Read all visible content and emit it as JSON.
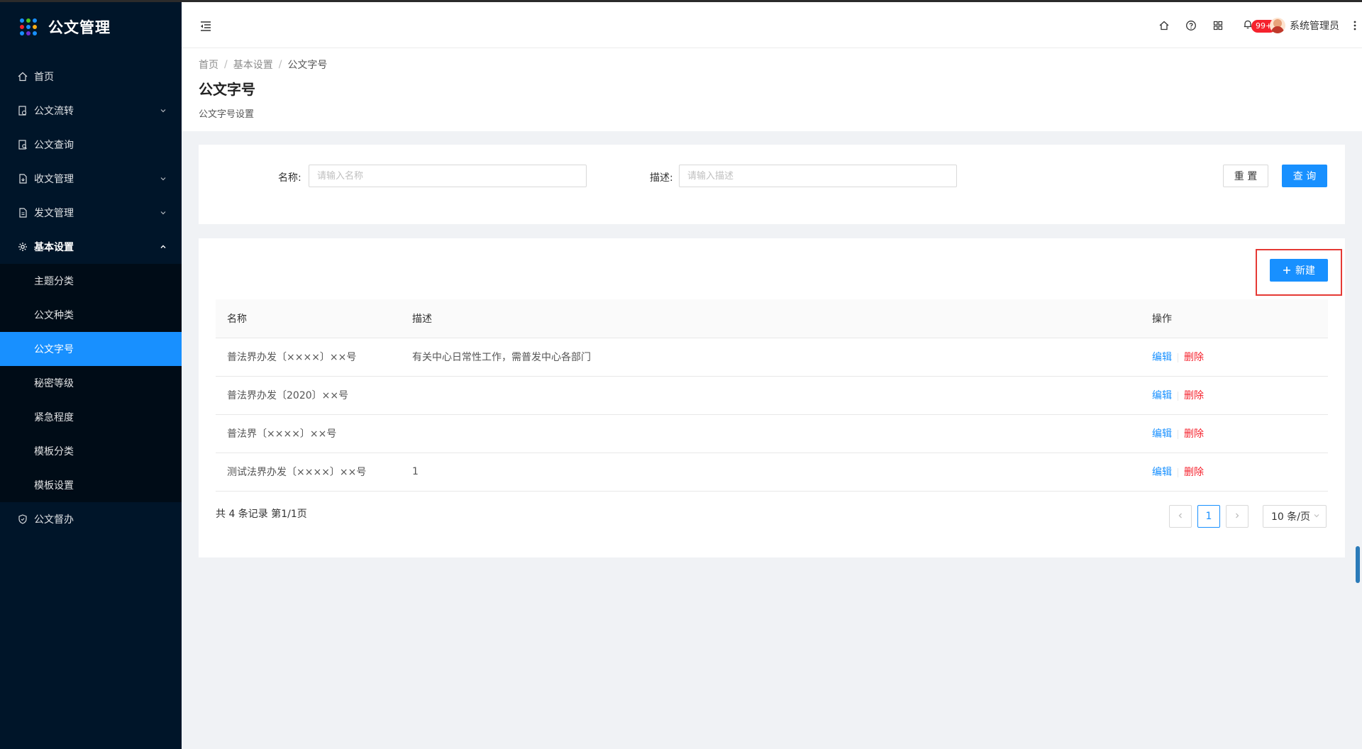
{
  "app": {
    "title": "公文管理"
  },
  "sidebar": {
    "items": [
      {
        "label": "首页",
        "icon": "home-icon"
      },
      {
        "label": "公文流转",
        "icon": "document-flow-icon"
      },
      {
        "label": "公文查询",
        "icon": "document-search-icon"
      },
      {
        "label": "收文管理",
        "icon": "inbox-document-icon"
      },
      {
        "label": "发文管理",
        "icon": "outbox-document-icon"
      },
      {
        "label": "基本设置",
        "icon": "gear-icon"
      },
      {
        "label": "公文督办",
        "icon": "shield-icon"
      }
    ],
    "submenu": [
      {
        "label": "主题分类"
      },
      {
        "label": "公文种类"
      },
      {
        "label": "公文字号"
      },
      {
        "label": "秘密等级"
      },
      {
        "label": "紧急程度"
      },
      {
        "label": "模板分类"
      },
      {
        "label": "模板设置"
      }
    ]
  },
  "header": {
    "notification_badge": "99+",
    "username": "系统管理员"
  },
  "breadcrumb": {
    "items": [
      "首页",
      "基本设置",
      "公文字号"
    ]
  },
  "page": {
    "title": "公文字号",
    "description": "公文字号设置"
  },
  "search": {
    "name_label": "名称:",
    "name_placeholder": "请输入名称",
    "desc_label": "描述:",
    "desc_placeholder": "请输入描述",
    "reset_label": "重 置",
    "query_label": "查 询"
  },
  "table": {
    "new_label": "新建",
    "columns": [
      "名称",
      "描述",
      "操作"
    ],
    "rows": [
      {
        "name": "普法界办发〔××××〕××号",
        "desc": "有关中心日常性工作，需普发中心各部门",
        "edit": "编辑",
        "delete": "删除"
      },
      {
        "name": "普法界办发〔2020〕××号",
        "desc": "",
        "edit": "编辑",
        "delete": "删除"
      },
      {
        "name": "普法界〔××××〕××号",
        "desc": "",
        "edit": "编辑",
        "delete": "删除"
      },
      {
        "name": "测试法界办发〔××××〕××号",
        "desc": "1",
        "edit": "编辑",
        "delete": "删除"
      }
    ]
  },
  "pagination": {
    "summary": "共 4 条记录 第1/1页",
    "current_page": "1",
    "page_size": "10 条/页"
  },
  "colors": {
    "sidebar_bg": "#001529",
    "primary": "#1890ff",
    "danger": "#f5222d"
  }
}
